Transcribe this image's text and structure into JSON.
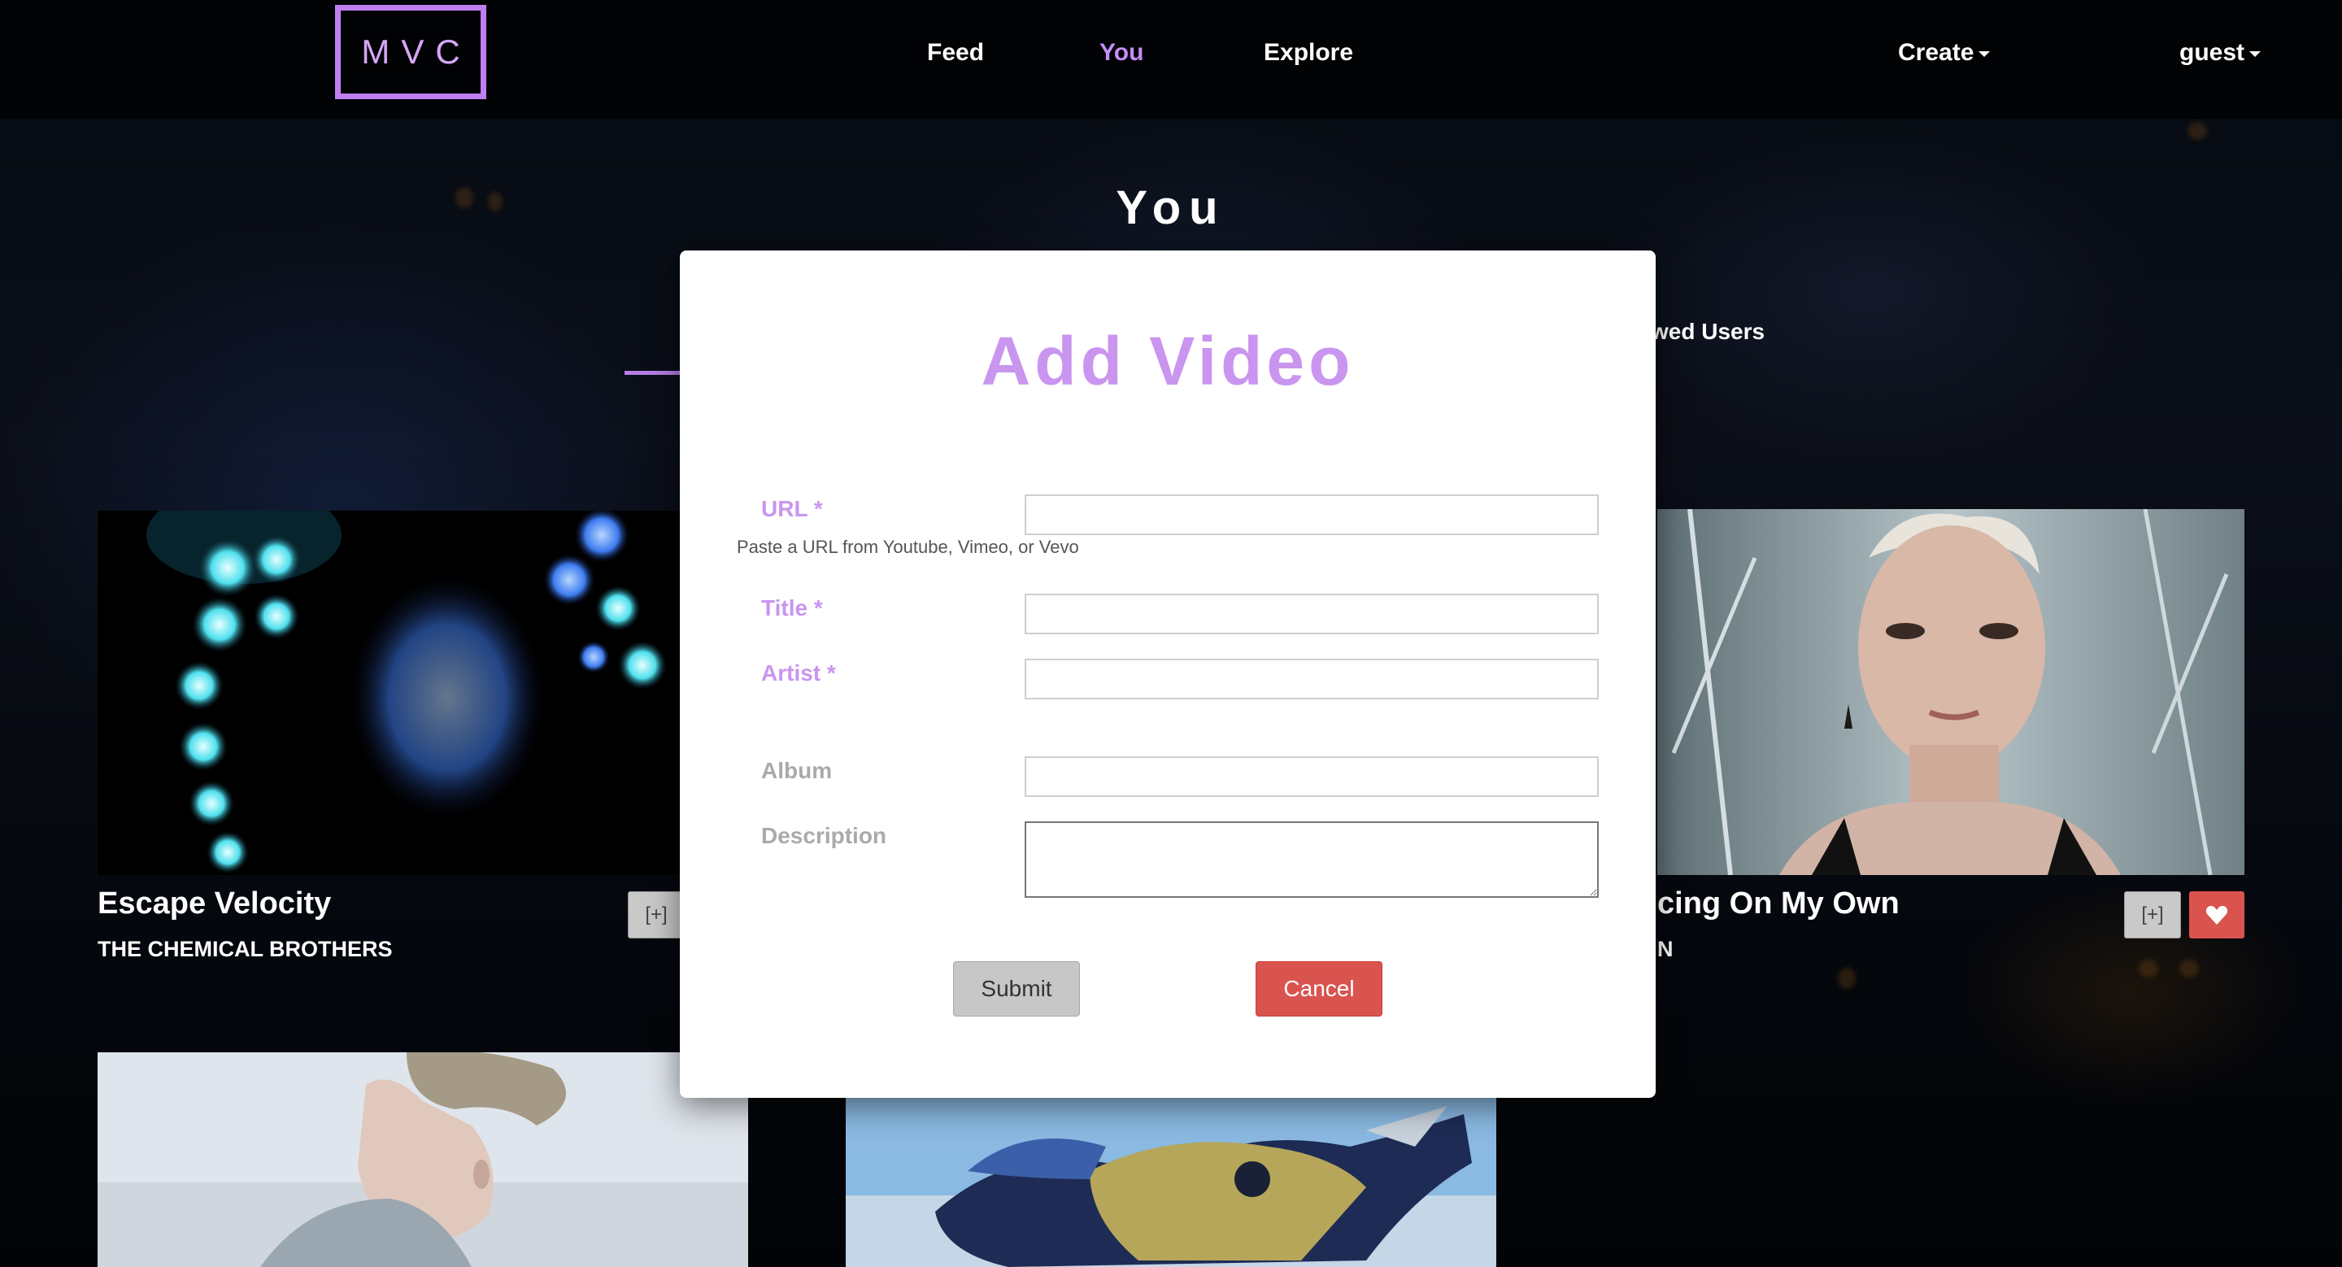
{
  "brand": {
    "logo_text": "MVC",
    "accent_color": "#c995ef"
  },
  "nav": {
    "items": [
      {
        "label": "Feed",
        "active": false
      },
      {
        "label": "You",
        "active": true
      },
      {
        "label": "Explore",
        "active": false
      }
    ],
    "create_label": "Create",
    "user_label": "guest"
  },
  "page": {
    "title": "You",
    "tab_partial_label": "wed Users"
  },
  "videos": [
    {
      "title": "Escape Velocity",
      "artist": "THE CHEMICAL BROTHERS",
      "add_label": "[+]"
    },
    {
      "title": "cing On My Own",
      "artist": "N",
      "add_label": "[+]",
      "liked": true
    }
  ],
  "modal": {
    "title": "Add Video",
    "fields": {
      "url": {
        "label": "URL *",
        "value": "",
        "help": "Paste a URL from Youtube, Vimeo, or Vevo"
      },
      "title": {
        "label": "Title *",
        "value": ""
      },
      "artist": {
        "label": "Artist *",
        "value": ""
      },
      "album": {
        "label": "Album",
        "value": ""
      },
      "description": {
        "label": "Description",
        "value": ""
      }
    },
    "submit_label": "Submit",
    "cancel_label": "Cancel"
  },
  "colors": {
    "like_button": "#d9534f",
    "cancel_button": "#d9534f",
    "submit_button": "#c7c7c7"
  }
}
